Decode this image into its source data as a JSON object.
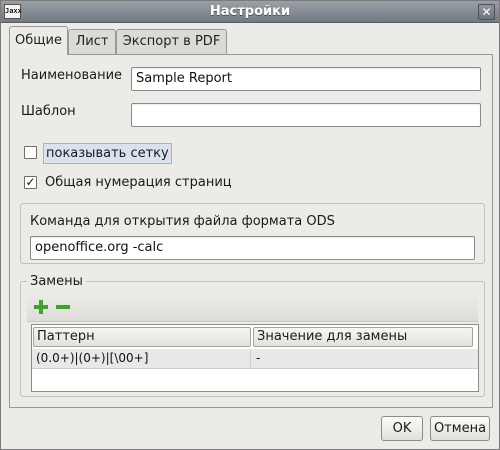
{
  "window": {
    "title": "Настройки",
    "app_icon_text": "Jaxx",
    "close_glyph": "✕"
  },
  "tabs": [
    {
      "label": "Общие"
    },
    {
      "label": "Лист"
    },
    {
      "label": "Экспорт в PDF"
    }
  ],
  "general": {
    "name_label": "Наименование",
    "name_value": "Sample Report",
    "template_label": "Шаблон",
    "template_value": "",
    "show_grid": {
      "label": "показывать сетку",
      "checked": false
    },
    "page_numbering": {
      "label": "Общая нумерация страниц",
      "checked": true
    },
    "ods_command": {
      "label": "Команда для открытия файла формата ODS",
      "value": "openoffice.org -calc"
    }
  },
  "replacements": {
    "title": "Замены",
    "add_icon": "plus-icon",
    "remove_icon": "minus-icon",
    "accent_add": "#3fa22f",
    "accent_remove": "#3fa22f",
    "columns": [
      "Паттерн",
      "Значение для замены"
    ],
    "rows": [
      [
        "(0.0+)|(0+)|[\\00+]",
        "-"
      ]
    ]
  },
  "footer": {
    "ok_label": "OK",
    "cancel_label": "Отмена"
  }
}
